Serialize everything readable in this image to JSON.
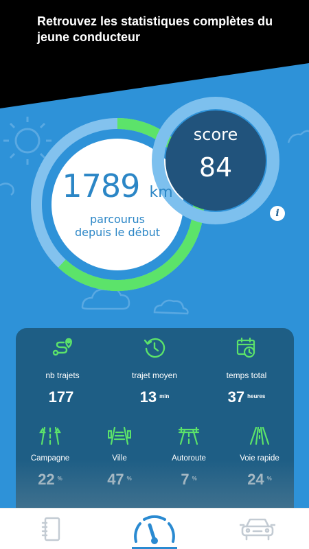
{
  "header": {
    "title": "Retrouvez les statistiques complètes du jeune conducteur"
  },
  "distance": {
    "value": "1789",
    "unit": "km",
    "caption_line1": "parcourus",
    "caption_line2": "depuis le début",
    "progress_fraction": 0.62
  },
  "score": {
    "label": "score",
    "value": "84"
  },
  "info": {
    "glyph": "i"
  },
  "stats": [
    {
      "label": "nb trajets",
      "value": "177",
      "unit": "",
      "icon": "route-icon"
    },
    {
      "label": "trajet moyen",
      "value": "13",
      "unit": "min",
      "icon": "history-clock-icon"
    },
    {
      "label": "temps total",
      "value": "37",
      "unit": "heures",
      "icon": "calendar-clock-icon"
    }
  ],
  "roads": [
    {
      "label": "Campagne",
      "value": "22",
      "unit": "%",
      "icon": "country-road-icon"
    },
    {
      "label": "Ville",
      "value": "47",
      "unit": "%",
      "icon": "city-road-icon"
    },
    {
      "label": "Autoroute",
      "value": "7",
      "unit": "%",
      "icon": "highway-icon"
    },
    {
      "label": "Voie rapide",
      "value": "24",
      "unit": "%",
      "icon": "expressway-icon"
    }
  ],
  "tabs": [
    {
      "name": "notebook-tab",
      "icon": "notebook-icon",
      "active": false
    },
    {
      "name": "dashboard-tab",
      "icon": "speedometer-icon",
      "active": true
    },
    {
      "name": "car-tab",
      "icon": "car-icon",
      "active": false
    }
  ],
  "colors": {
    "sky": "#2e92d8",
    "card": "#1e5e85",
    "progress": "#5ce36a",
    "accent": "#2a8ad1"
  }
}
